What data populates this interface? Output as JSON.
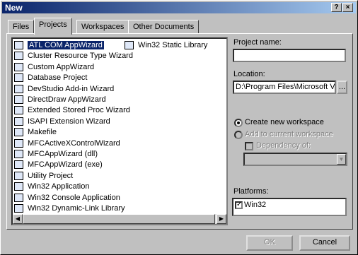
{
  "title": "New",
  "titlebar_buttons": {
    "help": "?",
    "close": "×"
  },
  "tabs": [
    "Files",
    "Projects",
    "Workspaces",
    "Other Documents"
  ],
  "active_tab": "Projects",
  "projects_col1": [
    {
      "label": "ATL COM AppWizard",
      "selected": true
    },
    {
      "label": "Cluster Resource Type Wizard"
    },
    {
      "label": "Custom AppWizard"
    },
    {
      "label": "Database Project"
    },
    {
      "label": "DevStudio Add-in Wizard"
    },
    {
      "label": "DirectDraw AppWizard"
    },
    {
      "label": "Extended Stored Proc Wizard"
    },
    {
      "label": "ISAPI Extension Wizard"
    },
    {
      "label": "Makefile"
    },
    {
      "label": "MFCActiveXControlWizard"
    },
    {
      "label": "MFCAppWizard (dll)"
    },
    {
      "label": "MFCAppWizard (exe)"
    },
    {
      "label": "Utility Project"
    },
    {
      "label": "Win32 Application"
    },
    {
      "label": "Win32 Console Application"
    },
    {
      "label": "Win32 Dynamic-Link Library"
    }
  ],
  "projects_col2": [
    {
      "label": "Win32 Static Library"
    }
  ],
  "project_name": {
    "label": "Project name:",
    "value": ""
  },
  "location": {
    "label": "Location:",
    "value": "D:\\Program Files\\Microsoft Visu",
    "browse": "..."
  },
  "workspace_options": {
    "create_new": "Create new workspace",
    "add_current": "Add to current workspace",
    "dependency": "Dependency of:"
  },
  "platforms": {
    "label": "Platforms:",
    "items": [
      {
        "label": "Win32",
        "checked": true
      }
    ]
  },
  "buttons": {
    "ok": "OK",
    "cancel": "Cancel"
  },
  "icons": {
    "project": "project-icon",
    "dropdown": "chevron-down-icon"
  }
}
